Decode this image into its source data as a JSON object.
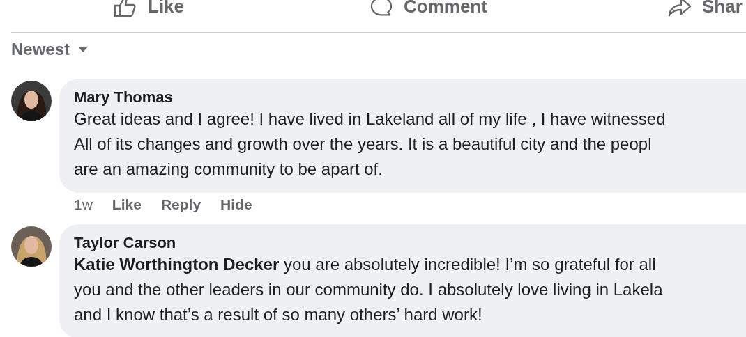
{
  "actions": [
    {
      "kind": "like",
      "label": "Like"
    },
    {
      "kind": "comment",
      "label": "Comment"
    },
    {
      "kind": "share",
      "label": "Shar"
    }
  ],
  "sort": {
    "label": "Newest"
  },
  "comments": [
    {
      "author": "Mary Thomas",
      "text": "Great ideas and I agree! I have lived in Lakeland all of my life , I have witnessed\nAll of its changes and growth over the years. It is a beautiful city and the peopl\nare an amazing community to be apart of.",
      "time": "1w",
      "links": [
        "Like",
        "Reply",
        "Hide"
      ]
    },
    {
      "author": "Taylor Carson",
      "text": "**Katie Worthington Decker** you are absolutely incredible! I’m so grateful for all\nyou and the other leaders in our community do. I absolutely love living in Lakela\nand I know that’s a result of so many others’ hard work!"
    }
  ]
}
